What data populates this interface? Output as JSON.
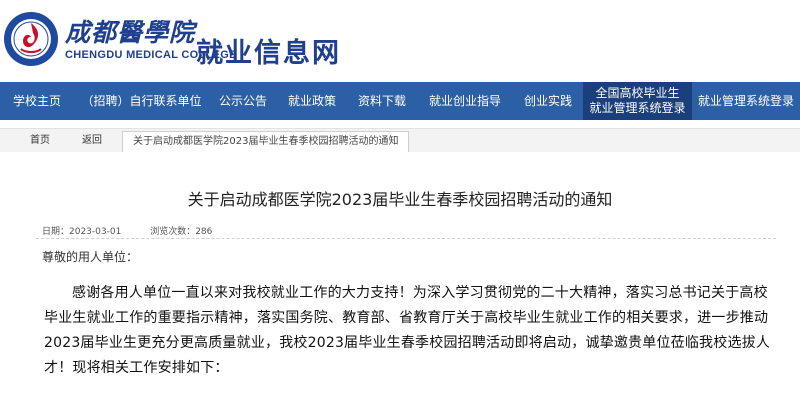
{
  "header": {
    "school_name_cn": "成都醫學院",
    "school_name_en": "CHENGDU MEDICAL COLLEGE",
    "site_title": "就业信息网",
    "logo_icon": "school-emblem-icon"
  },
  "nav": {
    "items": [
      {
        "label": "学校主页"
      },
      {
        "label": "（招聘）自行联系单位"
      },
      {
        "label": "公示公告"
      },
      {
        "label": "就业政策"
      },
      {
        "label": "资料下载"
      },
      {
        "label": "就业创业指导"
      },
      {
        "label": "创业实践"
      }
    ],
    "national_system": {
      "line1": "全国高校毕业生",
      "line2": "就业管理系统登录"
    },
    "system_login": "就业管理系统登录"
  },
  "breadcrumb": {
    "home": "首页",
    "back": "返回",
    "current": "关于启动成都医学院2023届毕业生春季校园招聘活动的通知"
  },
  "article": {
    "title": "关于启动成都医学院2023届毕业生春季校园招聘活动的通知",
    "date": "日期：2023-03-01",
    "views": "浏览次数：286",
    "greeting": "尊敬的用人单位：",
    "paragraph": "感谢各用人单位一直以来对我校就业工作的大力支持！为深入学习贯彻党的二十大精神，落实习总书记关于高校毕业生就业工作的重要指示精神，落实国务院、教育部、省教育厅关于高校毕业生就业工作的相关要求，进一步推动2023届毕业生更充分更高质量就业，我校2023届毕业生春季校园招聘活动即将启动，诚挚邀贵单位莅临我校选拔人才！现将相关工作安排如下："
  },
  "colors": {
    "nav_bg": "#2b5fa6",
    "nav_active_bg": "#1a3f7a",
    "brand_blue": "#1f3f8f",
    "emblem_red": "#c8102e"
  }
}
